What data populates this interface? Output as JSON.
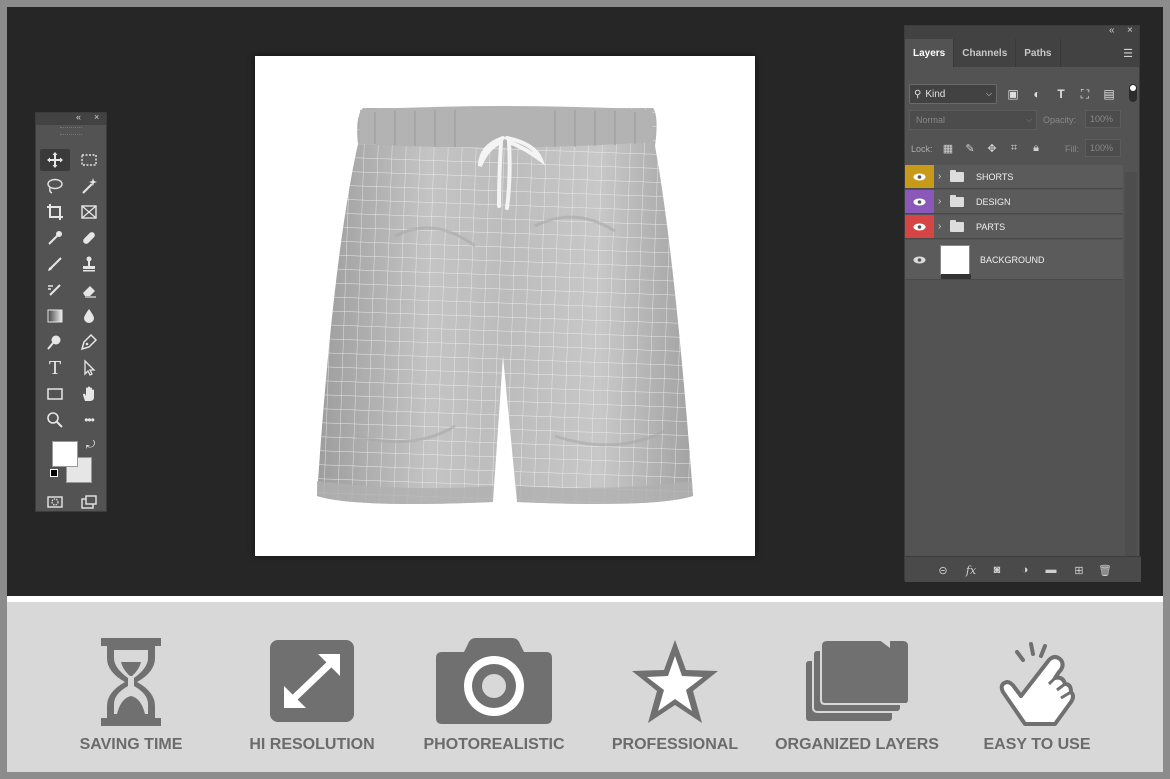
{
  "panel_layers": {
    "tabs": [
      "Layers",
      "Channels",
      "Paths"
    ],
    "kind_label": "Kind",
    "blend_mode": "Normal",
    "opacity_label": "Opacity:",
    "opacity_value": "100%",
    "lock_label": "Lock:",
    "fill_label": "Fill:",
    "fill_value": "100%",
    "layers": [
      {
        "name": "SHORTS",
        "type": "group",
        "eye_color": "#c79a1a"
      },
      {
        "name": "DESIGN",
        "type": "group",
        "eye_color": "#8a58b8"
      },
      {
        "name": "PARTS",
        "type": "group",
        "eye_color": "#d64545"
      },
      {
        "name": "BACKGROUND",
        "type": "pixel",
        "eye_color": "#5b5b5b"
      }
    ],
    "footer_icons": [
      "link-icon",
      "fx-icon",
      "mask-icon",
      "adjustment-icon",
      "folder-icon",
      "new-layer-icon",
      "trash-icon"
    ]
  },
  "toolbar": {
    "tools": [
      "move-icon",
      "marquee-icon",
      "lasso-icon",
      "magic-wand-icon",
      "crop-icon",
      "frame-icon",
      "eyedropper-icon",
      "healing-icon",
      "brush-icon",
      "stamp-icon",
      "history-brush-icon",
      "eraser-icon",
      "gradient-icon",
      "blur-icon",
      "dodge-icon",
      "pen-icon",
      "type-icon",
      "path-select-icon",
      "rectangle-icon",
      "hand-icon",
      "zoom-icon",
      "more-icon"
    ],
    "type_glyph": "T",
    "more_glyph": "•••",
    "foreground_color": "#ffffff",
    "background_color": "#e6e6e6"
  },
  "features": [
    {
      "label": "SAVING TIME",
      "icon": "hourglass-icon"
    },
    {
      "label": "HI RESOLUTION",
      "icon": "expand-icon"
    },
    {
      "label": "PHOTOREALISTIC",
      "icon": "camera-icon"
    },
    {
      "label": "PROFESSIONAL",
      "icon": "star-icon"
    },
    {
      "label": "ORGANIZED LAYERS",
      "icon": "folders-icon"
    },
    {
      "label": "EASY TO USE",
      "icon": "pointer-hand-icon"
    }
  ],
  "colors": {
    "workspace": "#262626",
    "panel": "#535353",
    "feature_bar": "#d8d8d8",
    "feature_icon": "#707070"
  }
}
